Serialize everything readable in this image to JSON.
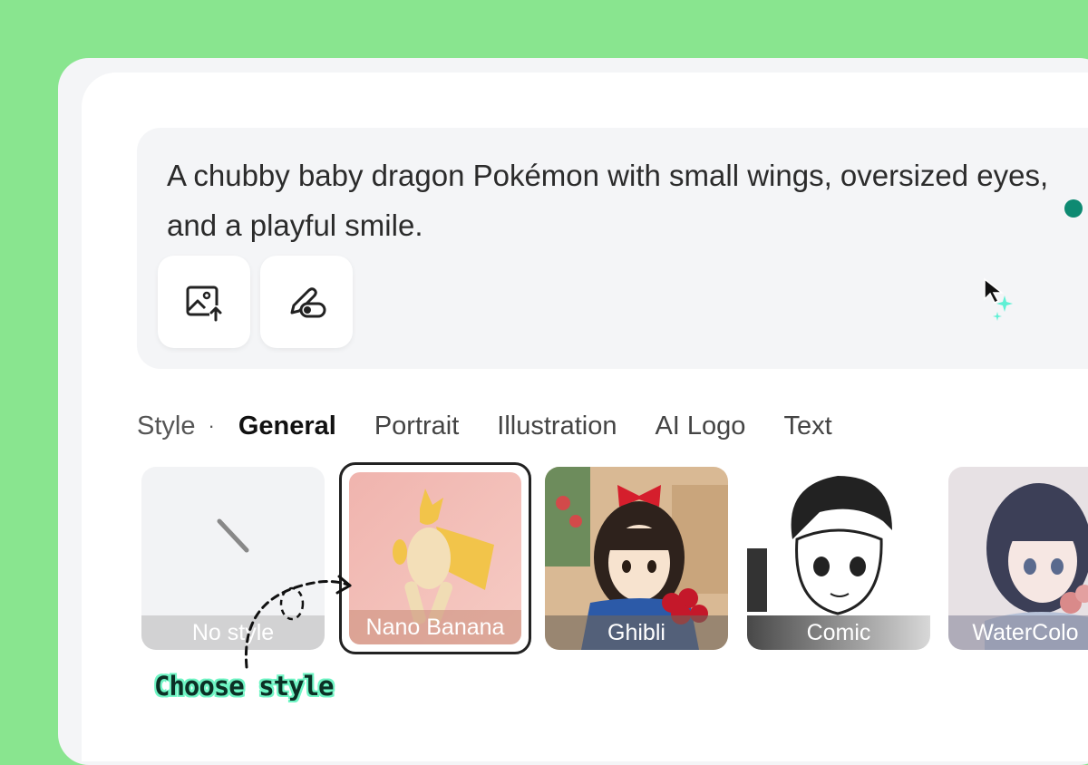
{
  "prompt": {
    "text": "A chubby baby dragon Pokémon with small wings, oversized eyes, and a playful smile."
  },
  "tools": [
    {
      "icon": "image-upload-icon"
    },
    {
      "icon": "brush-toggle-icon"
    }
  ],
  "tabs": {
    "label": "Style",
    "items": [
      "General",
      "Portrait",
      "Illustration",
      "AI Logo",
      "Text"
    ],
    "active": "General"
  },
  "styles": [
    {
      "label": "No style"
    },
    {
      "label": "Nano Banana",
      "selected": true
    },
    {
      "label": "Ghibli"
    },
    {
      "label": "Comic"
    },
    {
      "label": "WaterColo"
    }
  ],
  "annotation": {
    "text": "Choose style"
  },
  "colors": {
    "background": "#89e58f",
    "accent_dot": "#0e8a72",
    "annotation_highlight": "#6ff5c4"
  }
}
